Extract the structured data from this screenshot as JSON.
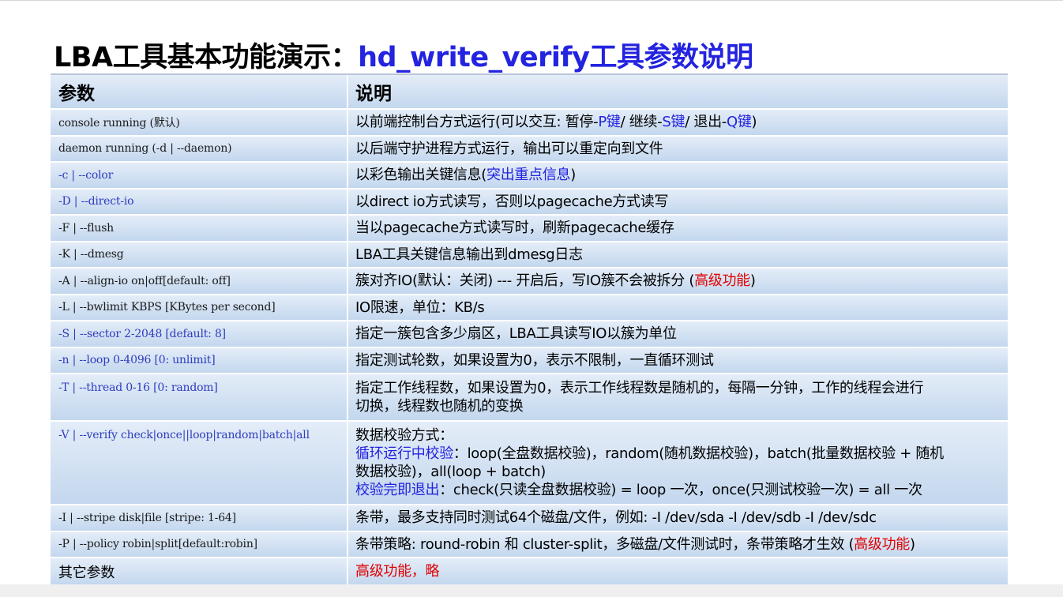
{
  "title": {
    "main": "LBA工具基本功能演示：",
    "accent": "hd_write_verify工具参数说明"
  },
  "table": {
    "headers": [
      "参数",
      "说明"
    ],
    "rows": [
      {
        "param": "console running (默认)",
        "desc_a": "以前端控制台方式运行(可以交互: 暂停-",
        "k1": "P键",
        "desc_b": " / 继续-",
        "k2": "S键",
        "desc_c": " / 退出-",
        "k3": "Q键",
        "desc_d": ")"
      },
      {
        "param": "daemon  running (-d | --daemon)",
        "desc": "以后端守护进程方式运行，输出可以重定向到文件"
      },
      {
        "param": "-c | --color",
        "desc_a": "以彩色输出关键信息(",
        "hl": "突出重点信息",
        "desc_b": ")"
      },
      {
        "param": "-D | --direct-io",
        "desc": "以direct io方式读写，否则以pagecache方式读写"
      },
      {
        "param": "-F | --flush",
        "desc": "当以pagecache方式读写时，刷新pagecache缓存"
      },
      {
        "param": "-K | --dmesg",
        "desc": "LBA工具关键信息输出到dmesg日志"
      },
      {
        "param": "-A | --align-io on|off[default: off]",
        "desc_a": "簇对齐IO(默认：关闭) --- 开启后，写IO簇不会被拆分 (",
        "red": "高级功能",
        "desc_b": ")"
      },
      {
        "param": "-L | --bwlimit KBPS   [KBytes per second]",
        "desc": "IO限速，单位：KB/s"
      },
      {
        "param": "-S | --sector  2-2048 [default: 8]",
        "desc": "指定一簇包含多少扇区，LBA工具读写IO以簇为单位"
      },
      {
        "param": "-n | --loop    0-4096 [0: unlimit]",
        "desc": "指定测试轮数，如果设置为0，表示不限制，一直循环测试"
      },
      {
        "param": "-T | --thread  0-16   [0:  random]",
        "desc_l1": "指定工作线程数，如果设置为0，表示工作线程数是随机的，每隔一分钟，工作的线程会进行",
        "desc_l2": "切换，线程数也随机的变换"
      },
      {
        "param": "-V | --verify  check|once||loop|random|batch|all",
        "l1": "数据校验方式：",
        "l2_hl": "循环运行中校验",
        "l2": "：loop(全盘数据校验)，random(随机数据校验)，batch(批量数据校验 + 随机",
        "l3": "数据校验)，all(loop + batch)",
        "l4_hl": "校验完即退出",
        "l4": "：check(只读全盘数据校验) = loop 一次，once(只测试校验一次) = all 一次"
      },
      {
        "param": "-I | --stripe  disk|file [stripe:  1-64]",
        "desc": "条带，最多支持同时测试64个磁盘/文件，例如: -I /dev/sda -I /dev/sdb -I /dev/sdc"
      },
      {
        "param": "-P | --policy robin|split[default:robin]",
        "desc_a": "条带策略: round-robin 和 cluster-split，多磁盘/文件测试时，条带策略才生效  (",
        "red": "高级功能",
        "desc_b": ")"
      },
      {
        "param": "其它参数",
        "red": "高级功能，略"
      }
    ]
  }
}
